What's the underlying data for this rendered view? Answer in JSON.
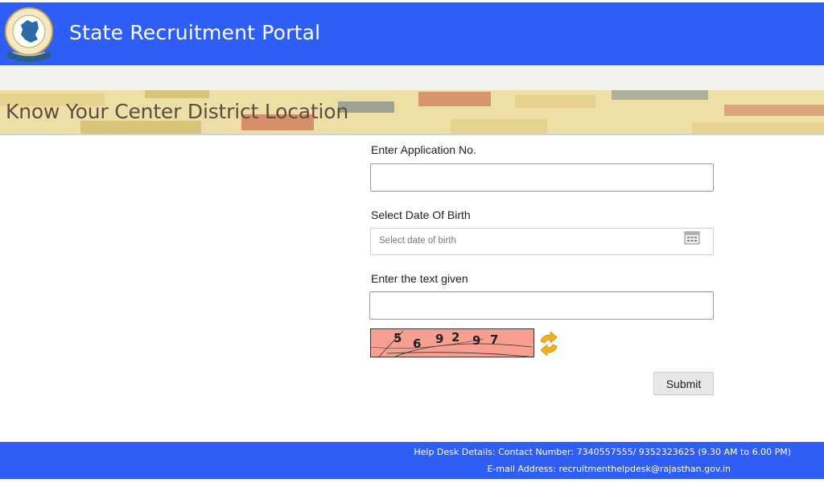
{
  "header": {
    "title": "State Recruitment Portal",
    "logo_icon": "rajasthan-emblem-icon",
    "bg_color": "#2f5ef6"
  },
  "banner": {
    "title": "Know Your Center District Location"
  },
  "form": {
    "application_label": "Enter Application No.",
    "application_value": "",
    "dob_label": "Select Date Of Birth",
    "dob_placeholder": "Select date of birth",
    "dob_icon": "calendar-icon",
    "captcha_label": "Enter the text given",
    "captcha_value": "",
    "captcha_digits": [
      "5",
      "6",
      "9",
      "2",
      "9",
      "7"
    ],
    "captcha_bg_color": "#f79f90",
    "refresh_icon": "refresh-icon",
    "submit_label": "Submit"
  },
  "footer": {
    "helpdesk": "Help Desk Details: Contact Number: 7340557555/ 9352323625 (9.30 AM to 6.00 PM)",
    "email": "E-mail Address: recruitmenthelpdesk@rajasthan.gov.in",
    "bg_color": "#2f5ef6"
  }
}
